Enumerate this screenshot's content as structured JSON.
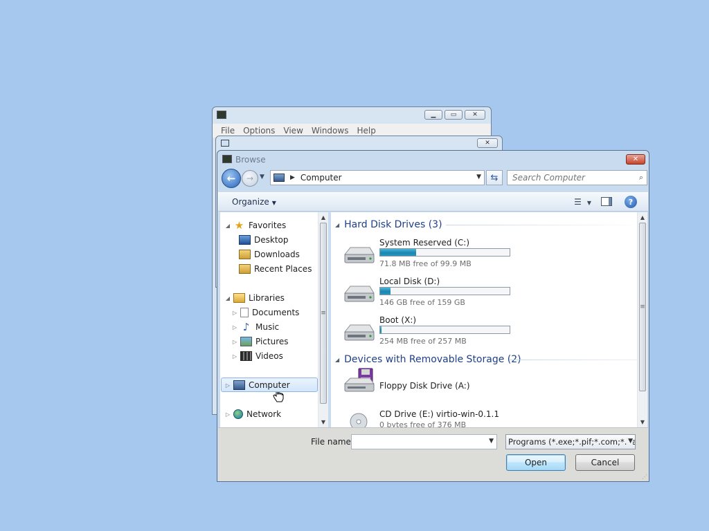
{
  "back_window": {
    "menu": [
      "File",
      "Options",
      "View",
      "Windows",
      "Help"
    ]
  },
  "dialog": {
    "title": "Browse",
    "address_path": "Computer",
    "search_placeholder": "Search Computer",
    "organize_label": "Organize",
    "nav": {
      "favorites": "Favorites",
      "desktop": "Desktop",
      "downloads": "Downloads",
      "recent_places": "Recent Places",
      "libraries": "Libraries",
      "documents": "Documents",
      "music": "Music",
      "pictures": "Pictures",
      "videos": "Videos",
      "computer": "Computer",
      "network": "Network"
    },
    "groups": {
      "hdd": "Hard Disk Drives (3)",
      "removable": "Devices with Removable Storage (2)"
    },
    "drives": [
      {
        "name": "System Reserved (C:)",
        "free": "71.8 MB free of 99.9 MB",
        "used_fraction": 0.28
      },
      {
        "name": "Local Disk (D:)",
        "free": "146 GB free of 159 GB",
        "used_fraction": 0.08
      },
      {
        "name": "Boot (X:)",
        "free": "254 MB free of 257 MB",
        "used_fraction": 0.01
      }
    ],
    "removable": [
      {
        "name": "Floppy Disk Drive (A:)"
      },
      {
        "name": "CD Drive (E:) virtio-win-0.1.1",
        "free": "0 bytes free of 376 MB"
      }
    ],
    "file_name_label": "File name:",
    "file_name_value": "",
    "filter_value": "Programs (*.exe;*.pif;*.com;*.bat;*.cmd)",
    "open_label": "Open",
    "cancel_label": "Cancel"
  },
  "colors": {
    "desktop": "#a6c8ee",
    "group_header": "#1e3f8a",
    "drive_bar": "#1b86b1"
  }
}
